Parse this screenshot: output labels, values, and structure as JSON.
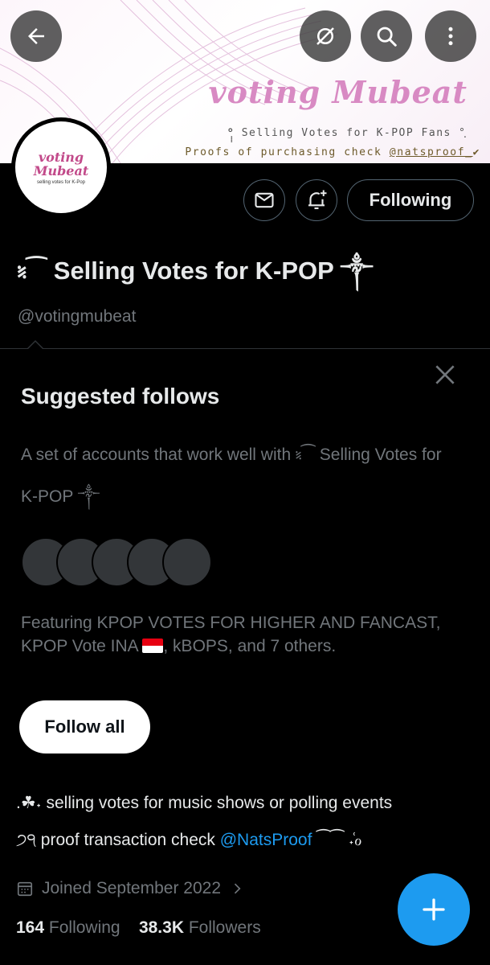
{
  "banner": {
    "title": "voting Mubeat",
    "subtitle": "°ฺฺฺฺ Selling Votes for K-POP Fans °ฺ",
    "proof_prefix": "Proofs of purchasing check ",
    "proof_handle": "@natsproof_",
    "proof_mark": "✔"
  },
  "avatar": {
    "line1": "voting",
    "line2": "Mubeat",
    "line3": "selling votes for K-Pop"
  },
  "actions": {
    "following_label": "Following"
  },
  "profile": {
    "display_name": "⹏⁀ Selling Votes for K-POP ༒",
    "handle": "@votingmubeat"
  },
  "suggested": {
    "title": "Suggested follows",
    "description": "A set of accounts that work well with ⹏⁀ Selling Votes for K-POP ༒",
    "featuring_text": "Featuring KPOP VOTES FOR HIGHER AND FANCAST, KPOP Vote INA",
    "featuring_tail": ", kBOPS, and 7 others.",
    "follow_all_label": "Follow all"
  },
  "bio": {
    "line1": ".☘︎˖ selling votes for music shows or polling events",
    "line2_prefix": "੭੧ proof transaction check ",
    "line2_link": "@NatsProof",
    "line2_suffix": " ⁀⁀ ˖͑ℴ"
  },
  "meta": {
    "joined": "Joined September 2022",
    "following_count": "164",
    "following_label": "Following",
    "followers_count": "38.3K",
    "followers_label": "Followers"
  },
  "colors": {
    "accent": "#1d9bf0",
    "banner_title": "#d88ac3",
    "avatar_text": "#c24a8a"
  },
  "icons": [
    "back-arrow-icon",
    "eye-off-icon",
    "search-icon",
    "more-vertical-icon",
    "mail-icon",
    "bell-plus-icon",
    "close-icon",
    "calendar-icon",
    "chevron-right-icon",
    "plus-icon"
  ]
}
